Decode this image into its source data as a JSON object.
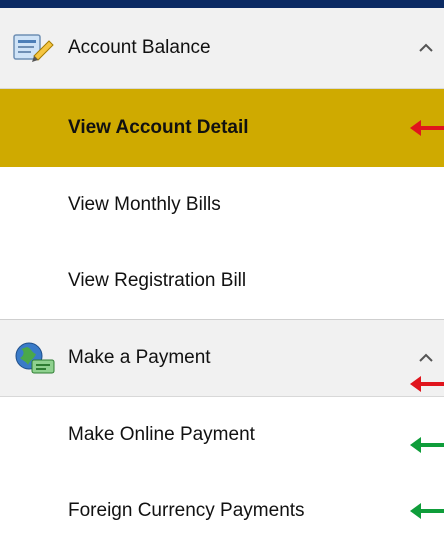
{
  "colors": {
    "top_rule": "#0b2a63",
    "header_bg": "#f1f1f1",
    "active_bg": "#cfaa00",
    "arrow_red": "#e0151d",
    "arrow_green": "#0f9d3a"
  },
  "sections": [
    {
      "label": "Account Balance",
      "icon": "document-edit-icon",
      "chevron": "chevron-up-icon",
      "items": [
        {
          "label": "View Account Detail",
          "active": true,
          "annotation": "red-arrow"
        },
        {
          "label": "View Monthly Bills",
          "active": false
        },
        {
          "label": "View Registration Bill",
          "active": false
        }
      ]
    },
    {
      "label": "Make a Payment",
      "icon": "globe-payment-icon",
      "chevron": "chevron-up-icon",
      "annotation": "red-arrow",
      "items": [
        {
          "label": "Make Online Payment",
          "active": false,
          "annotation": "green-arrow"
        },
        {
          "label": "Foreign Currency Payments",
          "active": false,
          "annotation": "green-arrow"
        }
      ]
    }
  ]
}
